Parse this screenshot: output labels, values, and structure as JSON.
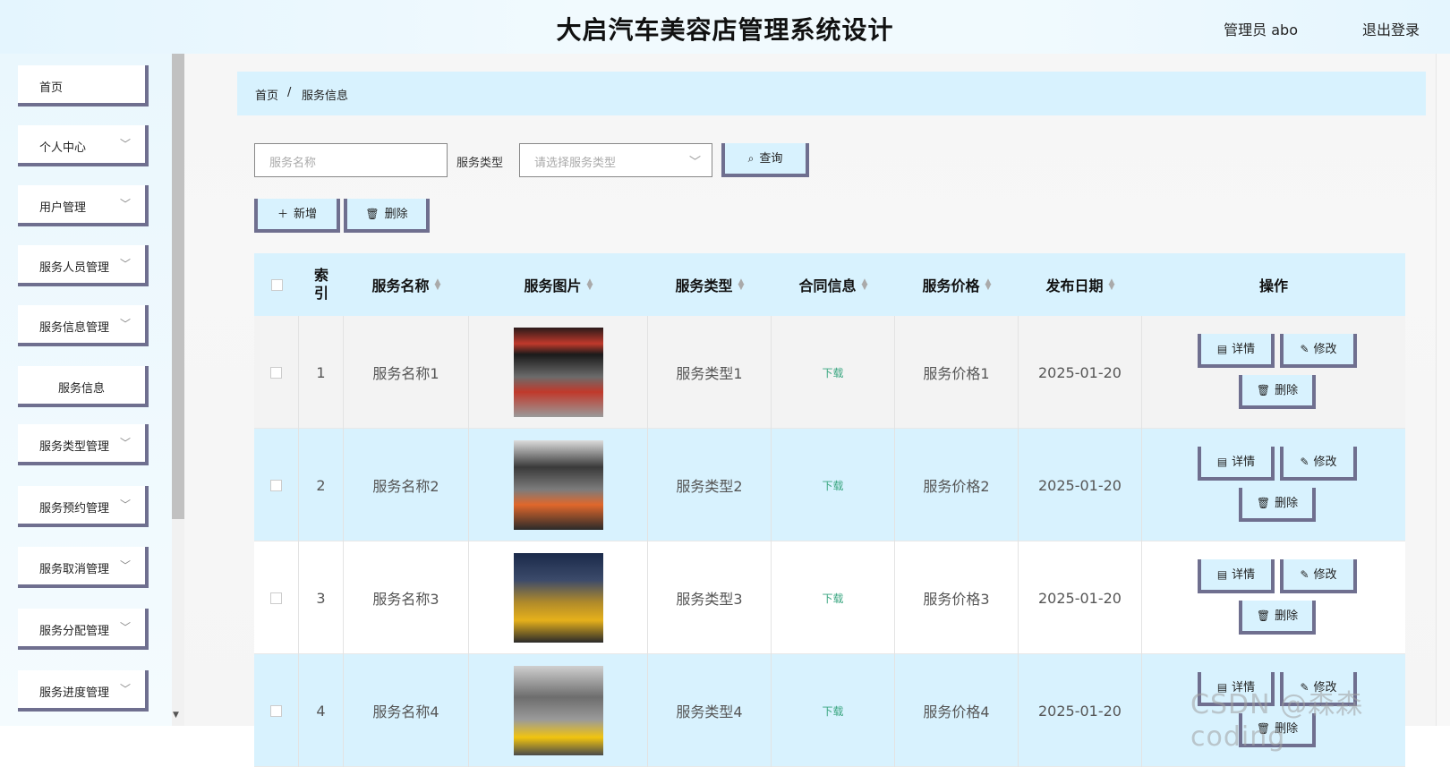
{
  "app": {
    "title": "大启汽车美容店管理系统设计",
    "user": "管理员 abo",
    "logout": "退出登录"
  },
  "sidebar": {
    "items": [
      {
        "label": "首页",
        "has_children": false
      },
      {
        "label": "个人中心",
        "has_children": true
      },
      {
        "label": "用户管理",
        "has_children": true
      },
      {
        "label": "服务人员管理",
        "has_children": true
      },
      {
        "label": "服务信息管理",
        "has_children": true
      },
      {
        "label": "服务信息",
        "has_children": false,
        "sub": true
      },
      {
        "label": "服务类型管理",
        "has_children": true
      },
      {
        "label": "服务预约管理",
        "has_children": true
      },
      {
        "label": "服务取消管理",
        "has_children": true
      },
      {
        "label": "服务分配管理",
        "has_children": true
      },
      {
        "label": "服务进度管理",
        "has_children": true
      }
    ]
  },
  "breadcrumb": {
    "home": "首页",
    "separator": "/",
    "current": "服务信息"
  },
  "search": {
    "name_placeholder": "服务名称",
    "type_label": "服务类型",
    "type_placeholder": "请选择服务类型",
    "query_label": "查询"
  },
  "toolbar": {
    "add_label": "新增",
    "delete_label": "删除"
  },
  "table": {
    "columns": [
      "索\n引",
      "服务名称",
      "服务图片",
      "服务类型",
      "合同信息",
      "服务价格",
      "发布日期",
      "操作"
    ],
    "rows": [
      {
        "index": "1",
        "name": "服务名称1",
        "type": "服务类型1",
        "contract": "下载",
        "price": "服务价格1",
        "date": "2025-01-20"
      },
      {
        "index": "2",
        "name": "服务名称2",
        "type": "服务类型2",
        "contract": "下载",
        "price": "服务价格2",
        "date": "2025-01-20"
      },
      {
        "index": "3",
        "name": "服务名称3",
        "type": "服务类型3",
        "contract": "下载",
        "price": "服务价格3",
        "date": "2025-01-20"
      },
      {
        "index": "4",
        "name": "服务名称4",
        "type": "服务类型4",
        "contract": "下载",
        "price": "服务价格4",
        "date": "2025-01-20"
      }
    ],
    "actions": {
      "detail": "详情",
      "edit": "修改",
      "delete": "删除"
    }
  },
  "watermark": "CSDN @森森 coding",
  "colors": {
    "accent": "#d8f2fe",
    "border": "#6f6f8f",
    "download": "#3aa680"
  }
}
